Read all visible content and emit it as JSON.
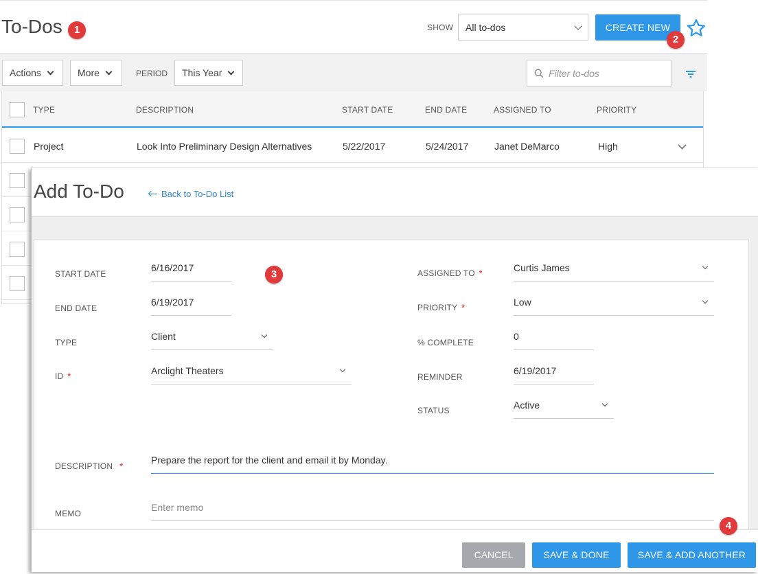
{
  "header": {
    "title": "To-Dos",
    "show_label": "SHOW",
    "show_value": "All to-dos",
    "create_label": "CREATE NEW"
  },
  "toolbar": {
    "actions_label": "Actions",
    "more_label": "More",
    "period_label": "PERIOD",
    "period_value": "This Year",
    "filter_placeholder": "Filter to-dos"
  },
  "table": {
    "columns": [
      "TYPE",
      "DESCRIPTION",
      "START DATE",
      "END DATE",
      "ASSIGNED TO",
      "PRIORITY"
    ],
    "rows": [
      {
        "type": "Project",
        "description": "Look Into Preliminary Design Alternatives",
        "start_date": "5/22/2017",
        "end_date": "5/24/2017",
        "assigned_to": "Janet DeMarco",
        "priority": "High"
      }
    ]
  },
  "dialog": {
    "title": "Add To-Do",
    "back_label": "Back to To-Do List",
    "fields": {
      "start_date": {
        "label": "START DATE",
        "value": "6/16/2017"
      },
      "end_date": {
        "label": "END DATE",
        "value": "6/19/2017"
      },
      "type": {
        "label": "TYPE",
        "value": "Client"
      },
      "id": {
        "label": "ID",
        "value": "Arclight Theaters"
      },
      "assigned_to": {
        "label": "ASSIGNED TO",
        "value": "Curtis James"
      },
      "priority": {
        "label": "PRIORITY",
        "value": "Low"
      },
      "percent_complete": {
        "label": "% COMPLETE",
        "value": "0"
      },
      "reminder": {
        "label": "REMINDER",
        "value": "6/19/2017"
      },
      "status": {
        "label": "STATUS",
        "value": "Active"
      },
      "description": {
        "label": "DESCRIPTION",
        "value": "Prepare the report for the client and email it by Monday."
      },
      "memo": {
        "label": "MEMO",
        "placeholder": "Enter memo"
      }
    },
    "required_mark": "*",
    "buttons": {
      "cancel": "CANCEL",
      "save_done": "SAVE & DONE",
      "save_another": "SAVE & ADD ANOTHER"
    }
  },
  "callouts": [
    "1",
    "2",
    "3",
    "4"
  ],
  "colors": {
    "primary": "#2e97e8",
    "badge": "#e03a3a",
    "cancel": "#a5a9ad",
    "required": "#d9534f"
  }
}
